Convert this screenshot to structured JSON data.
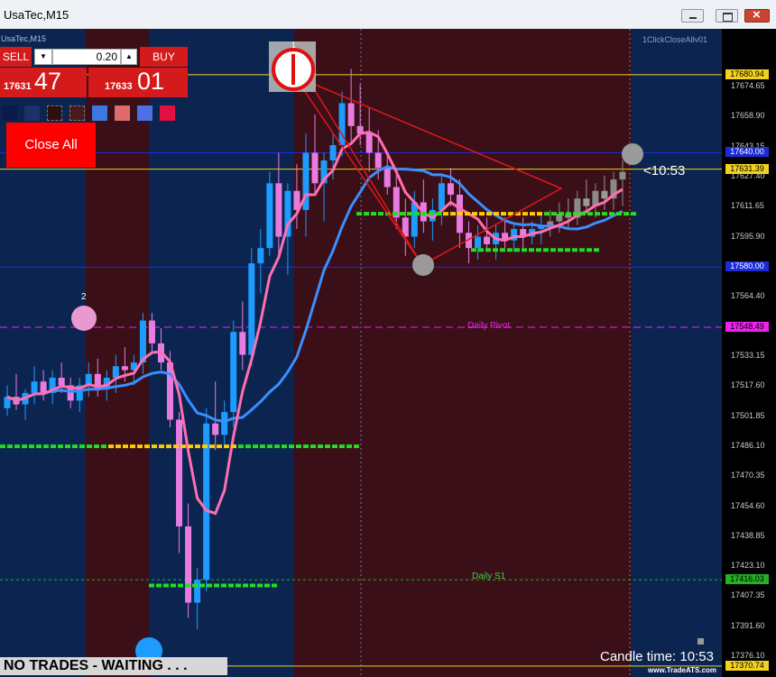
{
  "window": {
    "title": "UsaTec,M15"
  },
  "chart_data": {
    "type": "candlestick",
    "symbol_label": "UsaTec,M15",
    "ylim": [
      17365,
      17705
    ],
    "y_ticks": [
      "17674.65",
      "17658.90",
      "17643.15",
      "17627.40",
      "17611.65",
      "17595.90",
      "17580.15",
      "17564.40",
      "17548.65",
      "17533.15",
      "17517.60",
      "17501.85",
      "17486.10",
      "17470.35",
      "17454.60",
      "17438.85",
      "17423.10",
      "17407.35",
      "17391.60",
      "17376.10"
    ],
    "price_tags": [
      {
        "price": "17680.94",
        "color": "#f2d11f"
      },
      {
        "price": "17640.00",
        "color": "#1d2bd6"
      },
      {
        "price": "17631.39",
        "color": "#f2d11f"
      },
      {
        "price": "17580.00",
        "color": "#1d2bd6"
      },
      {
        "price": "17548.49",
        "color": "#ee22ee"
      },
      {
        "price": "17416.03",
        "color": "#22b322"
      },
      {
        "price": "17370.74",
        "color": "#f2d11f"
      }
    ],
    "levels": [
      {
        "name": "Daily Pivot",
        "price": 17548.49,
        "color": "#ee22ee"
      },
      {
        "name": "Daily S1",
        "price": 17416.03,
        "color": "#44cc44"
      }
    ],
    "candles": [
      [
        17506,
        17518,
        17502,
        17512
      ],
      [
        17512,
        17524,
        17505,
        17508
      ],
      [
        17508,
        17516,
        17500,
        17514
      ],
      [
        17514,
        17528,
        17508,
        17520
      ],
      [
        17520,
        17526,
        17510,
        17514
      ],
      [
        17514,
        17526,
        17508,
        17522
      ],
      [
        17522,
        17530,
        17514,
        17518
      ],
      [
        17518,
        17522,
        17506,
        17510
      ],
      [
        17510,
        17522,
        17504,
        17518
      ],
      [
        17518,
        17530,
        17512,
        17524
      ],
      [
        17524,
        17532,
        17512,
        17516
      ],
      [
        17516,
        17526,
        17510,
        17522
      ],
      [
        17522,
        17534,
        17514,
        17528
      ],
      [
        17528,
        17538,
        17520,
        17526
      ],
      [
        17526,
        17534,
        17518,
        17530
      ],
      [
        17530,
        17556,
        17524,
        17552
      ],
      [
        17552,
        17556,
        17536,
        17540
      ],
      [
        17540,
        17548,
        17526,
        17530
      ],
      [
        17530,
        17536,
        17496,
        17500
      ],
      [
        17500,
        17504,
        17430,
        17444
      ],
      [
        17444,
        17456,
        17396,
        17404
      ],
      [
        17404,
        17422,
        17390,
        17416
      ],
      [
        17416,
        17506,
        17410,
        17498
      ],
      [
        17498,
        17520,
        17484,
        17492
      ],
      [
        17492,
        17510,
        17486,
        17504
      ],
      [
        17504,
        17552,
        17496,
        17546
      ],
      [
        17546,
        17562,
        17526,
        17534
      ],
      [
        17534,
        17590,
        17528,
        17582
      ],
      [
        17582,
        17600,
        17566,
        17590
      ],
      [
        17590,
        17630,
        17586,
        17624
      ],
      [
        17624,
        17640,
        17586,
        17596
      ],
      [
        17596,
        17624,
        17576,
        17620
      ],
      [
        17620,
        17634,
        17600,
        17610
      ],
      [
        17610,
        17650,
        17596,
        17640
      ],
      [
        17640,
        17660,
        17618,
        17624
      ],
      [
        17624,
        17640,
        17604,
        17636
      ],
      [
        17636,
        17650,
        17626,
        17644
      ],
      [
        17644,
        17672,
        17638,
        17666
      ],
      [
        17666,
        17684,
        17646,
        17654
      ],
      [
        17654,
        17676,
        17644,
        17650
      ],
      [
        17650,
        17664,
        17630,
        17640
      ],
      [
        17640,
        17652,
        17626,
        17632
      ],
      [
        17632,
        17640,
        17618,
        17622
      ],
      [
        17622,
        17632,
        17600,
        17606
      ],
      [
        17606,
        17616,
        17586,
        17596
      ],
      [
        17596,
        17620,
        17590,
        17614
      ],
      [
        17614,
        17626,
        17598,
        17604
      ],
      [
        17604,
        17616,
        17594,
        17610
      ],
      [
        17610,
        17628,
        17602,
        17624
      ],
      [
        17624,
        17632,
        17612,
        17618
      ],
      [
        17618,
        17626,
        17590,
        17598
      ],
      [
        17598,
        17604,
        17582,
        17590
      ],
      [
        17590,
        17602,
        17584,
        17596
      ],
      [
        17596,
        17606,
        17588,
        17592
      ],
      [
        17592,
        17602,
        17584,
        17598
      ],
      [
        17598,
        17606,
        17590,
        17594
      ],
      [
        17594,
        17602,
        17588,
        17600
      ],
      [
        17600,
        17606,
        17590,
        17596
      ],
      [
        17596,
        17604,
        17592,
        17600
      ],
      [
        17600,
        17608,
        17592,
        17602
      ],
      [
        17602,
        17610,
        17596,
        17604
      ],
      [
        17604,
        17614,
        17598,
        17608
      ],
      [
        17608,
        17616,
        17600,
        17606
      ],
      [
        17606,
        17620,
        17602,
        17616
      ],
      [
        17616,
        17626,
        17608,
        17612
      ],
      [
        17612,
        17624,
        17606,
        17620
      ],
      [
        17620,
        17628,
        17610,
        17616
      ],
      [
        17616,
        17630,
        17610,
        17626
      ],
      [
        17626,
        17636,
        17612,
        17630
      ]
    ],
    "annotations": [
      {
        "text": "1",
        "price": 17690
      },
      {
        "text": "2",
        "price": 17550
      }
    ]
  },
  "trade_panel": {
    "sell_label": "SELL",
    "buy_label": "BUY",
    "volume": "0.20",
    "bid_prefix": "17631",
    "bid_big": "47",
    "ask_prefix": "17633",
    "ask_big": "01",
    "close_all_label": "Close All",
    "swatch_colors": [
      "#0a1a4a",
      "#1f2f6a",
      "#2a1010",
      "#4a1a1a",
      "#3b78e0",
      "#dd6c6c",
      "#4d6fe6",
      "#e01040"
    ],
    "down_glyph": "▼",
    "up_glyph": "▲"
  },
  "overlays": {
    "ea_name": "1ClickCloseAllv01",
    "countdown": "<10:53",
    "candle_time_label": "Candle time:",
    "candle_time_value": "10:53",
    "status": "NO TRADES - WAITING . . .",
    "brand": "www.TradeATS.com",
    "pivot_label": "Daily Pivot",
    "s1_label": "Daily S1",
    "arrow_1": "1",
    "arrow_2": "2"
  }
}
